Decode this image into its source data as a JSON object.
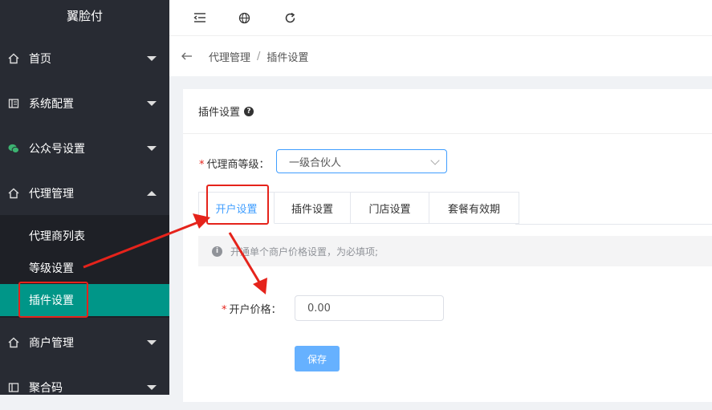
{
  "app": {
    "title": "翼脸付"
  },
  "sidebar": {
    "items": [
      {
        "label": "首页",
        "icon": "home-icon"
      },
      {
        "label": "系统配置",
        "icon": "config-icon"
      },
      {
        "label": "公众号设置",
        "icon": "wechat-icon"
      },
      {
        "label": "代理管理",
        "icon": "home-icon",
        "expanded": true
      },
      {
        "label": "商户管理",
        "icon": "home-icon"
      },
      {
        "label": "聚合码",
        "icon": "config-icon"
      }
    ],
    "subitems": [
      {
        "label": "代理商列表"
      },
      {
        "label": "等级设置"
      },
      {
        "label": "插件设置",
        "active": true
      }
    ]
  },
  "topbar": {
    "icons": [
      "collapse-menu-icon",
      "globe-icon",
      "refresh-icon"
    ]
  },
  "breadcrumb": {
    "items": [
      "代理管理",
      "插件设置"
    ],
    "separator": "/"
  },
  "card": {
    "title": "插件设置",
    "help_icon": "?",
    "level": {
      "required_mark": "*",
      "label": "代理商等级：",
      "value": "一级合伙人"
    },
    "tabs": [
      {
        "label": "开户设置",
        "active": true
      },
      {
        "label": "插件设置"
      },
      {
        "label": "门店设置"
      },
      {
        "label": "套餐有效期"
      }
    ],
    "notice": "开通单个商户价格设置，为必填项;",
    "price": {
      "required_mark": "*",
      "label": "开户价格：",
      "value": "0.00"
    },
    "save_label": "保存"
  },
  "colors": {
    "sidebar_bg": "#282b33",
    "active": "#009688",
    "accent": "#409eff",
    "annotation": "#e5231b"
  }
}
